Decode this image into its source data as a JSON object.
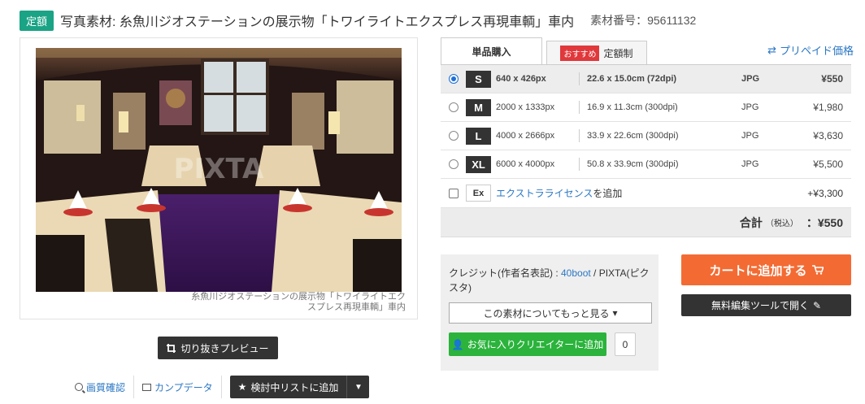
{
  "header": {
    "badge": "定額",
    "title": "写真素材: 糸魚川ジオステーションの展示物「トワイライトエクスプレス再現車輌」車内",
    "asset_number": "素材番号：95611132"
  },
  "image": {
    "caption": "糸魚川ジオステーションの展示物「トワイライトエクスプレス再現車輌」車内",
    "watermark": "PIXTA"
  },
  "actions_left": {
    "crop_preview": "切り抜きプレビュー",
    "quality_check": "画質確認",
    "comp_data": "カンプデータ",
    "add_to_list": "検討中リストに追加"
  },
  "tabs": {
    "single": "単品購入",
    "recommend_badge": "おすすめ",
    "subscription": "定額制",
    "prepaid": "プリペイド価格"
  },
  "sizes": [
    {
      "size": "S",
      "px": "640 x 426px",
      "cm": "22.6 x 15.0cm (72dpi)",
      "format": "JPG",
      "price": "¥550",
      "selected": true
    },
    {
      "size": "M",
      "px": "2000 x 1333px",
      "cm": "16.9 x 11.3cm (300dpi)",
      "format": "JPG",
      "price": "¥1,980",
      "selected": false
    },
    {
      "size": "L",
      "px": "4000 x 2666px",
      "cm": "33.9 x 22.6cm (300dpi)",
      "format": "JPG",
      "price": "¥3,630",
      "selected": false
    },
    {
      "size": "XL",
      "px": "6000 x 4000px",
      "cm": "50.8 x 33.9cm (300dpi)",
      "format": "JPG",
      "price": "¥5,500",
      "selected": false
    }
  ],
  "extra": {
    "badge": "Ex",
    "link": "エクストラライセンス",
    "suffix": "を追加",
    "price": "+¥3,300"
  },
  "total": {
    "label": "合計",
    "tax": "（税込）",
    "value": "：¥550"
  },
  "credit": {
    "prefix": "クレジット(作者名表記) : ",
    "author": "40boot",
    "suffix": " / PIXTA(ピクスタ)",
    "more_button": "この素材についてもっと見る",
    "favorite_button": "お気に入りクリエイターに追加",
    "favorite_count": "0"
  },
  "cart": {
    "add_to_cart": "カートに追加する",
    "edit_tool": "無料編集ツールで開く"
  },
  "colors": {
    "accent_orange": "#f36b33",
    "badge_teal": "#1aa385",
    "green": "#2bb33c",
    "link_blue": "#2b77c3"
  }
}
